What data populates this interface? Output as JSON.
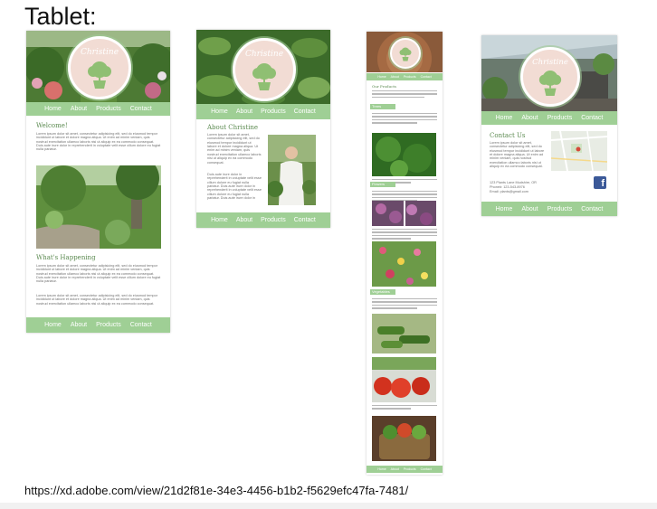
{
  "page": {
    "title": "Tablet:",
    "url": "https://xd.adobe.com/view/21d2f81e-34e3-4456-b1b2-f5629efc47fa-7481/"
  },
  "brand": {
    "logo_text": "Christine"
  },
  "nav": {
    "home": "Home",
    "about": "About",
    "products": "Products",
    "contact": "Contact"
  },
  "home_page": {
    "welcome_heading": "Welcome!",
    "welcome_body": "Lorem ipsum dolor sit amet, consectetur adipisicing elit, sed do eiusmod tempor incididunt ut labore et dolore magna aliqua. Ut enim ad minim veniam, quis nostrud exercitation ullamco laboris nisi ut aliquip ex ea commodo consequat. Duis aute irure dolor in reprehenderit in voluptate velit esse cillum dolore eu fugiat nulla pariatur.",
    "happening_heading": "What's Happening",
    "happening_body": "Lorem ipsum dolor sit amet, consectetur adipisicing elit, sed do eiusmod tempor incididunt ut labore et dolore magna aliqua. Ut enim ad minim veniam, quis nostrud exercitation ullamco laboris nisi ut aliquip ex ea commodo consequat. Duis aute irure dolor in reprehenderit in voluptate velit esse cillum dolore eu fugiat nulla pariatur.",
    "happening_body_2": "Lorem ipsum dolor sit amet, consectetur adipisicing elit, sed do eiusmod tempor incididunt ut labore et dolore magna aliqua. Ut enim ad minim veniam, quis nostrud exercitation ullamco laboris nisi ut aliquip ex ea commodo consequat."
  },
  "about_page": {
    "heading": "About Christine",
    "body": "Lorem ipsum dolor sit amet, consectetur adipisicing elit, sed do eiusmod tempor incididunt ut labore et dolore magna aliqua. Ut enim ad minim veniam, quis nostrud exercitation ullamco laboris nisi ut aliquip ex ea commodo consequat.",
    "body_2": "Duis aute irure dolor in reprehenderit in voluptate velit esse cillum dolore eu fugiat nulla pariatur. Duis aute irure dolor in reprehenderit in voluptate velit esse cillum dolore eu fugiat nulla pariatur. Duis aute irure dolor in"
  },
  "products_page": {
    "heading": "Our Products",
    "sections": [
      "Trees",
      "Flowers",
      "Vegetables"
    ]
  },
  "contact_page": {
    "heading": "Contact Us",
    "body": "Lorem ipsum dolor sit amet, consectetur adipisicing elit, sed do eiusmod tempor incididunt ut labore et dolore magna aliqua. Ut enim ad minim veniam, quis nostrud exercitation ullamco laboris nisi ut aliquip ex ea commodo consequat.",
    "address": "123 Plants Lane Mudshire, OR",
    "phone": "Phone#: 123-543-8976",
    "email": "Email: plants@gmail.com"
  },
  "colors": {
    "nav_green": "#9fcf95",
    "heading_green": "#5b8a50",
    "logo_fill": "#f2dcd4"
  }
}
